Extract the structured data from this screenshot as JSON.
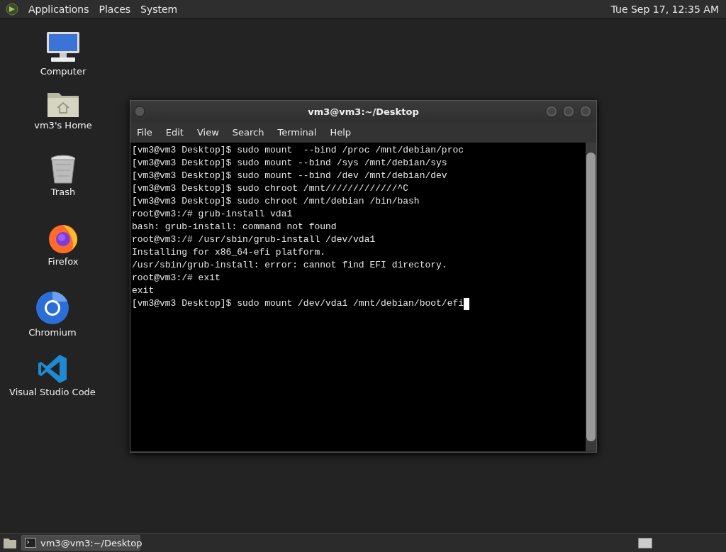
{
  "top_panel": {
    "menus": [
      "Applications",
      "Places",
      "System"
    ],
    "clock": "Tue Sep 17, 12:35 AM"
  },
  "desktop_icons": [
    {
      "kind": "computer",
      "label": "Computer"
    },
    {
      "kind": "home",
      "label": "vm3's Home"
    },
    {
      "kind": "trash",
      "label": "Trash"
    },
    {
      "kind": "firefox",
      "label": "Firefox"
    },
    {
      "kind": "chromium",
      "label": "Chromium"
    },
    {
      "kind": "vscode",
      "label": "Visual Studio Code"
    }
  ],
  "terminal_window": {
    "title": "vm3@vm3:~/Desktop",
    "menu": [
      "File",
      "Edit",
      "View",
      "Search",
      "Terminal",
      "Help"
    ],
    "lines": [
      "[vm3@vm3 Desktop]$ sudo mount  --bind /proc /mnt/debian/proc",
      "[vm3@vm3 Desktop]$ sudo mount --bind /sys /mnt/debian/sys",
      "[vm3@vm3 Desktop]$ sudo mount --bind /dev /mnt/debian/dev",
      "[vm3@vm3 Desktop]$ sudo chroot /mnt/////////////^C",
      "[vm3@vm3 Desktop]$ sudo chroot /mnt/debian /bin/bash",
      "root@vm3:/# grub-install vda1",
      "bash: grub-install: command not found",
      "root@vm3:/# /usr/sbin/grub-install /dev/vda1",
      "Installing for x86_64-efi platform.",
      "/usr/sbin/grub-install: error: cannot find EFI directory.",
      "root@vm3:/# exit",
      "exit",
      "[vm3@vm3 Desktop]$ sudo mount /dev/vda1 /mnt/debian/boot/efi"
    ]
  },
  "bottom_panel": {
    "tasks": [
      {
        "label": "vm3@vm3:~/Desktop",
        "selected": true
      }
    ]
  }
}
